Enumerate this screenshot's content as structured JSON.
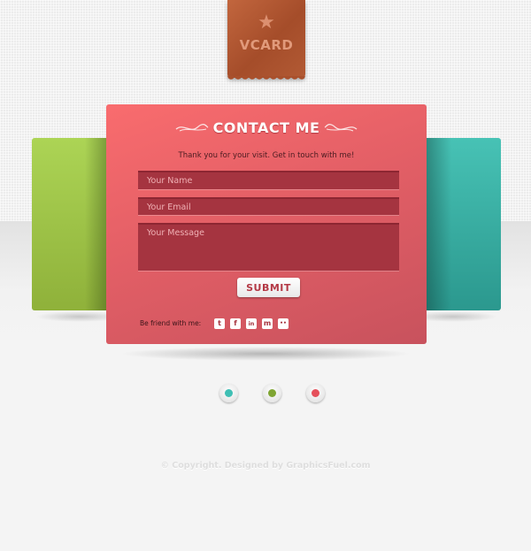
{
  "tag": {
    "icon": "star-icon",
    "label": "VCARD"
  },
  "contact": {
    "title": "CONTACT ME",
    "subtitle": "Thank you for your visit. Get in touch with me!",
    "fields": {
      "name_placeholder": "Your Name",
      "email_placeholder": "Your Email",
      "message_placeholder": "Your Message"
    },
    "submit_label": "SUBMIT",
    "friend_label": "Be friend with me:",
    "social": [
      {
        "name": "twitter",
        "glyph": "t"
      },
      {
        "name": "facebook",
        "glyph": "f"
      },
      {
        "name": "linkedin",
        "glyph": "in"
      },
      {
        "name": "myspace",
        "glyph": "m"
      },
      {
        "name": "flickr",
        "glyph": "••"
      }
    ]
  },
  "cards": {
    "left_color": "#a6cd4f",
    "main_color": "#f26a6d",
    "right_color": "#3fb6aa"
  },
  "pager": {
    "dots": [
      {
        "name": "teal",
        "color": "#3fbfb4"
      },
      {
        "name": "green",
        "color": "#7fa533"
      },
      {
        "name": "red",
        "color": "#e5505b"
      }
    ]
  },
  "footer": {
    "text": "© Copyright. Designed by GraphicsFuel.com"
  }
}
